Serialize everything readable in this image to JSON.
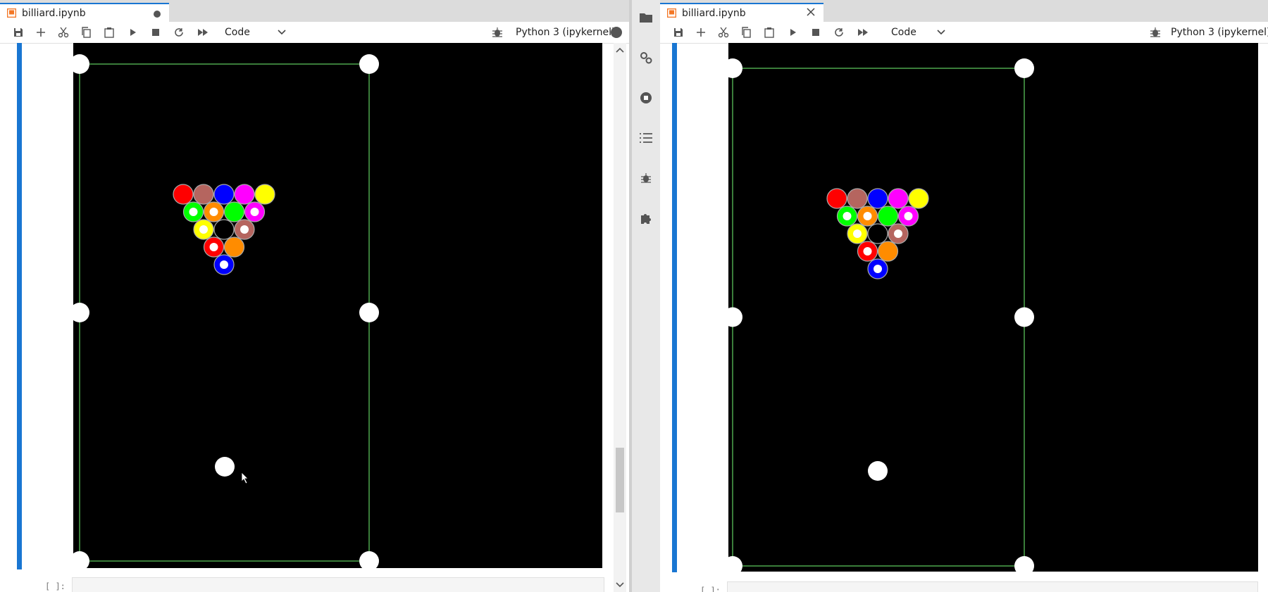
{
  "left": {
    "tab": {
      "title": "billiard.ipynb"
    },
    "toolbar": {
      "cell_type": "Code",
      "kernel_name": "Python 3 (ipykernel)"
    },
    "next_cell_prompt": "[ ]:"
  },
  "right": {
    "tab": {
      "title": "billiard.ipynb"
    },
    "toolbar": {
      "cell_type": "Code",
      "kernel_name": "Python 3 (ipykernel)"
    },
    "next_cell_prompt": "[ ]:"
  },
  "sidebar": {
    "icons": [
      "folder-icon",
      "running-terminals-icon",
      "stop-icon",
      "table-of-contents-icon",
      "debugger-icon",
      "extension-icon"
    ]
  },
  "toolbar_icons": [
    "save-icon",
    "add-cell-icon",
    "cut-icon",
    "copy-icon",
    "paste-icon",
    "run-icon",
    "stop-icon",
    "restart-icon",
    "fast-forward-icon"
  ],
  "table": {
    "felt_color": "#000000",
    "rail_color": "#3a7d3a",
    "pocket_color": "#ffffff",
    "cue_ball_color": "#ffffff",
    "rack_rows": [
      [
        {
          "color": "#ff0000",
          "striped": false
        },
        {
          "color": "#b5655f",
          "striped": false
        },
        {
          "color": "#0000ff",
          "striped": false
        },
        {
          "color": "#ff00ff",
          "striped": false
        },
        {
          "color": "#ffff00",
          "striped": false
        }
      ],
      [
        {
          "color": "#00ff00",
          "striped": true
        },
        {
          "color": "#ff8c00",
          "striped": true
        },
        {
          "color": "#00ff00",
          "striped": false
        },
        {
          "color": "#ff00ff",
          "striped": true
        }
      ],
      [
        {
          "color": "#ffff00",
          "striped": true
        },
        {
          "color": "#000000",
          "striped": false
        },
        {
          "color": "#b5655f",
          "striped": true
        }
      ],
      [
        {
          "color": "#ff0000",
          "striped": true
        },
        {
          "color": "#ff8c00",
          "striped": false
        }
      ],
      [
        {
          "color": "#0000ff",
          "striped": true
        }
      ]
    ]
  },
  "colors": {
    "accent": "#1976d2",
    "tab_icon": "#f37726"
  }
}
